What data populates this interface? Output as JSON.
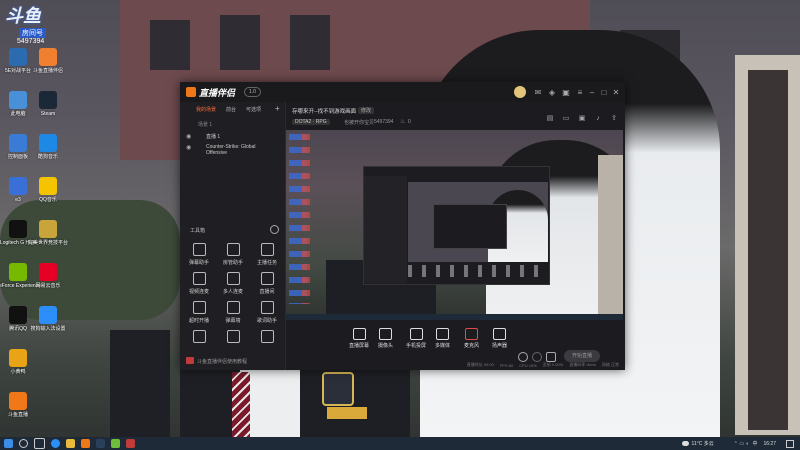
{
  "screen_logo": {
    "line1": "斗鱼",
    "room_label": "房间号",
    "room_no": "5497394"
  },
  "desktop_icons": [
    {
      "label": "5E对战平台",
      "icon": "5e-icon",
      "color": "#2b6cb0"
    },
    {
      "label": "斗鱼直播伴侣",
      "icon": "douyu-icon",
      "color": "#f08030"
    },
    {
      "label": "此电脑",
      "icon": "computer-icon",
      "color": "#4a90d9"
    },
    {
      "label": "Steam",
      "icon": "steam-icon",
      "color": "#1b2838"
    },
    {
      "label": "控制面板",
      "icon": "control-panel-icon",
      "color": "#3a7bd5"
    },
    {
      "label": "酷狗音乐",
      "icon": "kugou-icon",
      "color": "#1e88e5"
    },
    {
      "label": "e3",
      "icon": "e3-icon",
      "color": "#3a6fd8"
    },
    {
      "label": "QQ音乐",
      "icon": "qq-music-icon",
      "color": "#f5c400"
    },
    {
      "label": "Logitech G HUB",
      "icon": "logitech-icon",
      "color": "#111"
    },
    {
      "label": "完美世界竞技平台",
      "icon": "perfect-world-icon",
      "color": "#c9a43a"
    },
    {
      "label": "GeForce Experience",
      "icon": "geforce-icon",
      "color": "#76b900"
    },
    {
      "label": "网易云音乐",
      "icon": "netease-music-icon",
      "color": "#e60026"
    },
    {
      "label": "腾讯QQ",
      "icon": "qq-icon",
      "color": "#111"
    },
    {
      "label": "搜狗输入法设置",
      "icon": "sogou-icon",
      "color": "#2c8ef8"
    },
    {
      "label": "小黄鸭",
      "icon": "duck-icon",
      "color": "#e8a317"
    },
    {
      "label": "",
      "icon": "blank-icon",
      "color": "transparent"
    },
    {
      "label": "斗鱼直播",
      "icon": "douyu-live-icon",
      "color": "#f07818"
    },
    {
      "label": "",
      "icon": "blank-icon",
      "color": "transparent"
    }
  ],
  "app": {
    "logo_text": "直播伴侣",
    "version_badge": "1.0",
    "sidebar_tabs": [
      "我的场景",
      "前台",
      "可选项"
    ],
    "scene_header": "场景 1",
    "sources": [
      "直播 1",
      "Counter-Strike: Global Offensive"
    ],
    "tools_title": "工具箱",
    "tools": [
      {
        "label": "弹幕助手",
        "icon": "danmu-icon"
      },
      {
        "label": "房管助手",
        "icon": "room-manager-icon"
      },
      {
        "label": "主播任务",
        "icon": "task-icon"
      },
      {
        "label": "视频连麦",
        "icon": "video-link-icon"
      },
      {
        "label": "多人连麦",
        "icon": "multi-link-icon"
      },
      {
        "label": "直播间",
        "icon": "live-room-icon"
      },
      {
        "label": "超时开播",
        "icon": "timer-icon"
      },
      {
        "label": "弹幕墙",
        "icon": "danmu-wall-icon"
      },
      {
        "label": "歌词助手",
        "icon": "lyrics-icon"
      },
      {
        "label": "",
        "icon": "download-icon"
      },
      {
        "label": "",
        "icon": "download2-icon"
      },
      {
        "label": "",
        "icon": "more-icon"
      }
    ],
    "sidebar_footer": "斗鱼直播伴侣使用教程",
    "stream_title": "存哪来开--找不到游戏画面",
    "title_badge": "修改",
    "category_tag": "DOTA2 · RPG",
    "room_label": "也被开你宝贝",
    "room_id": "5497394",
    "fans": "0",
    "bottom_buttons": [
      {
        "label": "直播屏幕",
        "icon": "screen-icon"
      },
      {
        "label": "摄像头",
        "icon": "camera-icon"
      },
      {
        "label": "手机投屏",
        "icon": "phone-cast-icon"
      },
      {
        "label": "多媒体",
        "icon": "media-icon"
      },
      {
        "label": "麦克风",
        "icon": "mic-icon"
      },
      {
        "label": "扬声器",
        "icon": "speaker-icon"
      }
    ],
    "start_button": "开始直播",
    "status_items": [
      "直播时长 00:00",
      "FPS 60",
      "CPU 15%",
      "丢帧 0.00%",
      "直播码率 0kb/s",
      "网络 正常"
    ]
  },
  "taskbar": {
    "weather": "11°C 多云",
    "ime": "中",
    "time": "16:27",
    "search_label": "",
    "apps": [
      "start",
      "search",
      "task-view",
      "edge",
      "explorer",
      "douyu",
      "steam"
    ]
  }
}
